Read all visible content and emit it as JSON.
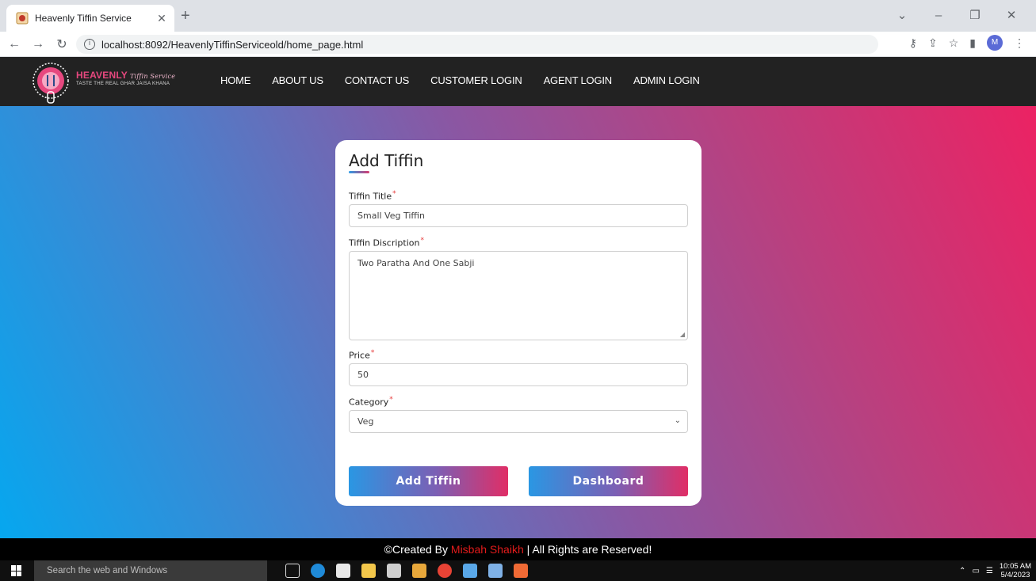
{
  "browser": {
    "tab_title": "Heavenly Tiffin Service",
    "url": "localhost:8092/HeavenlyTiffinServiceold/home_page.html"
  },
  "site": {
    "brand_name": "HEAVENLY",
    "brand_script": "Tiffin Service",
    "brand_tagline": "TASTE THE REAL GHAR JAISA KHANA",
    "nav": [
      "HOME",
      "ABOUT US",
      "CONTACT US",
      "CUSTOMER LOGIN",
      "AGENT LOGIN",
      "ADMIN LOGIN"
    ]
  },
  "form": {
    "title": "Add Tiffin",
    "fields": {
      "title_label": "Tiffin Title",
      "title_value": "Small Veg Tiffin",
      "description_label": "Tiffin Discription",
      "description_value": "Two Paratha And One Sabji",
      "price_label": "Price",
      "price_value": "50",
      "category_label": "Category",
      "category_value": "Veg"
    },
    "required_mark": "*",
    "submit_label": "Add Tiffin",
    "dashboard_label": "Dashboard"
  },
  "footer": {
    "prefix": "©Created By ",
    "author": "Misbah Shaikh",
    "suffix": " | All Rights are Reserved!"
  },
  "taskbar": {
    "search_placeholder": "Search the web and Windows",
    "time": "10:05 AM",
    "date": "5/4/2023"
  },
  "colors": {
    "header_bg": "#222222",
    "gradient_start": "#06a7ef",
    "gradient_end": "#ec2263",
    "brand": "#e7487f",
    "footer_author": "#e21b1b"
  }
}
